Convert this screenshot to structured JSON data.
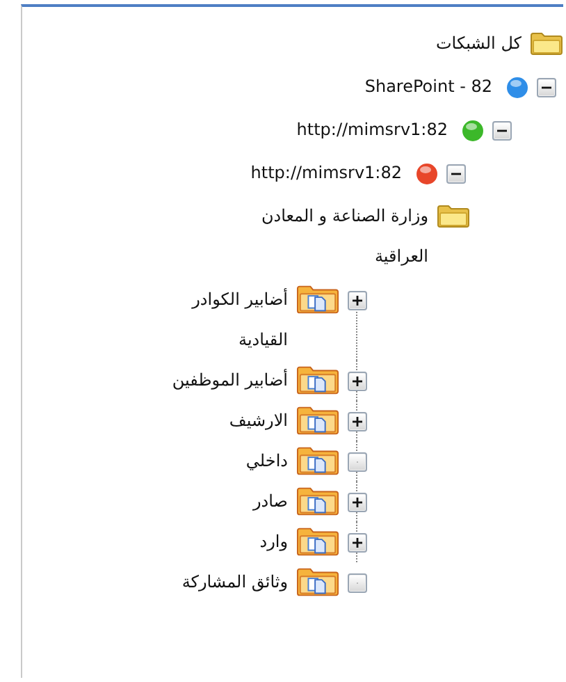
{
  "tree": [
    {
      "label": "كل الشبكات",
      "kind": "folder",
      "children": [
        {
          "label": "SharePoint - 82",
          "kind": "server",
          "color": "#2f8ee8",
          "has_children": true,
          "expanded": true,
          "children": [
            {
              "label": "http://mimsrv1:82",
              "kind": "server",
              "color": "#3cb82a",
              "has_children": true,
              "expanded": true,
              "children": [
                {
                  "label": "http://mimsrv1:82",
                  "kind": "server",
                  "color": "#e8462a",
                  "has_children": true,
                  "expanded": true,
                  "children": [
                    {
                      "label": "وزارة الصناعة و المعادن العراقية",
                      "kind": "folder",
                      "children": [
                        {
                          "label": "أضابير الكوادر القيادية",
                          "kind": "library",
                          "has_children": true,
                          "expanded": false
                        },
                        {
                          "label": "أضابير الموظفين",
                          "kind": "library",
                          "has_children": true,
                          "expanded": false
                        },
                        {
                          "label": "الارشيف",
                          "kind": "library",
                          "has_children": true,
                          "expanded": false
                        },
                        {
                          "label": "داخلي",
                          "kind": "library",
                          "has_children": false
                        },
                        {
                          "label": "صادر",
                          "kind": "library",
                          "has_children": true,
                          "expanded": false
                        },
                        {
                          "label": "وارد",
                          "kind": "library",
                          "has_children": true,
                          "expanded": false
                        },
                        {
                          "label": "وثائق المشاركة",
                          "kind": "library",
                          "has_children": false
                        }
                      ]
                    }
                  ]
                }
              ]
            }
          ]
        }
      ]
    }
  ]
}
